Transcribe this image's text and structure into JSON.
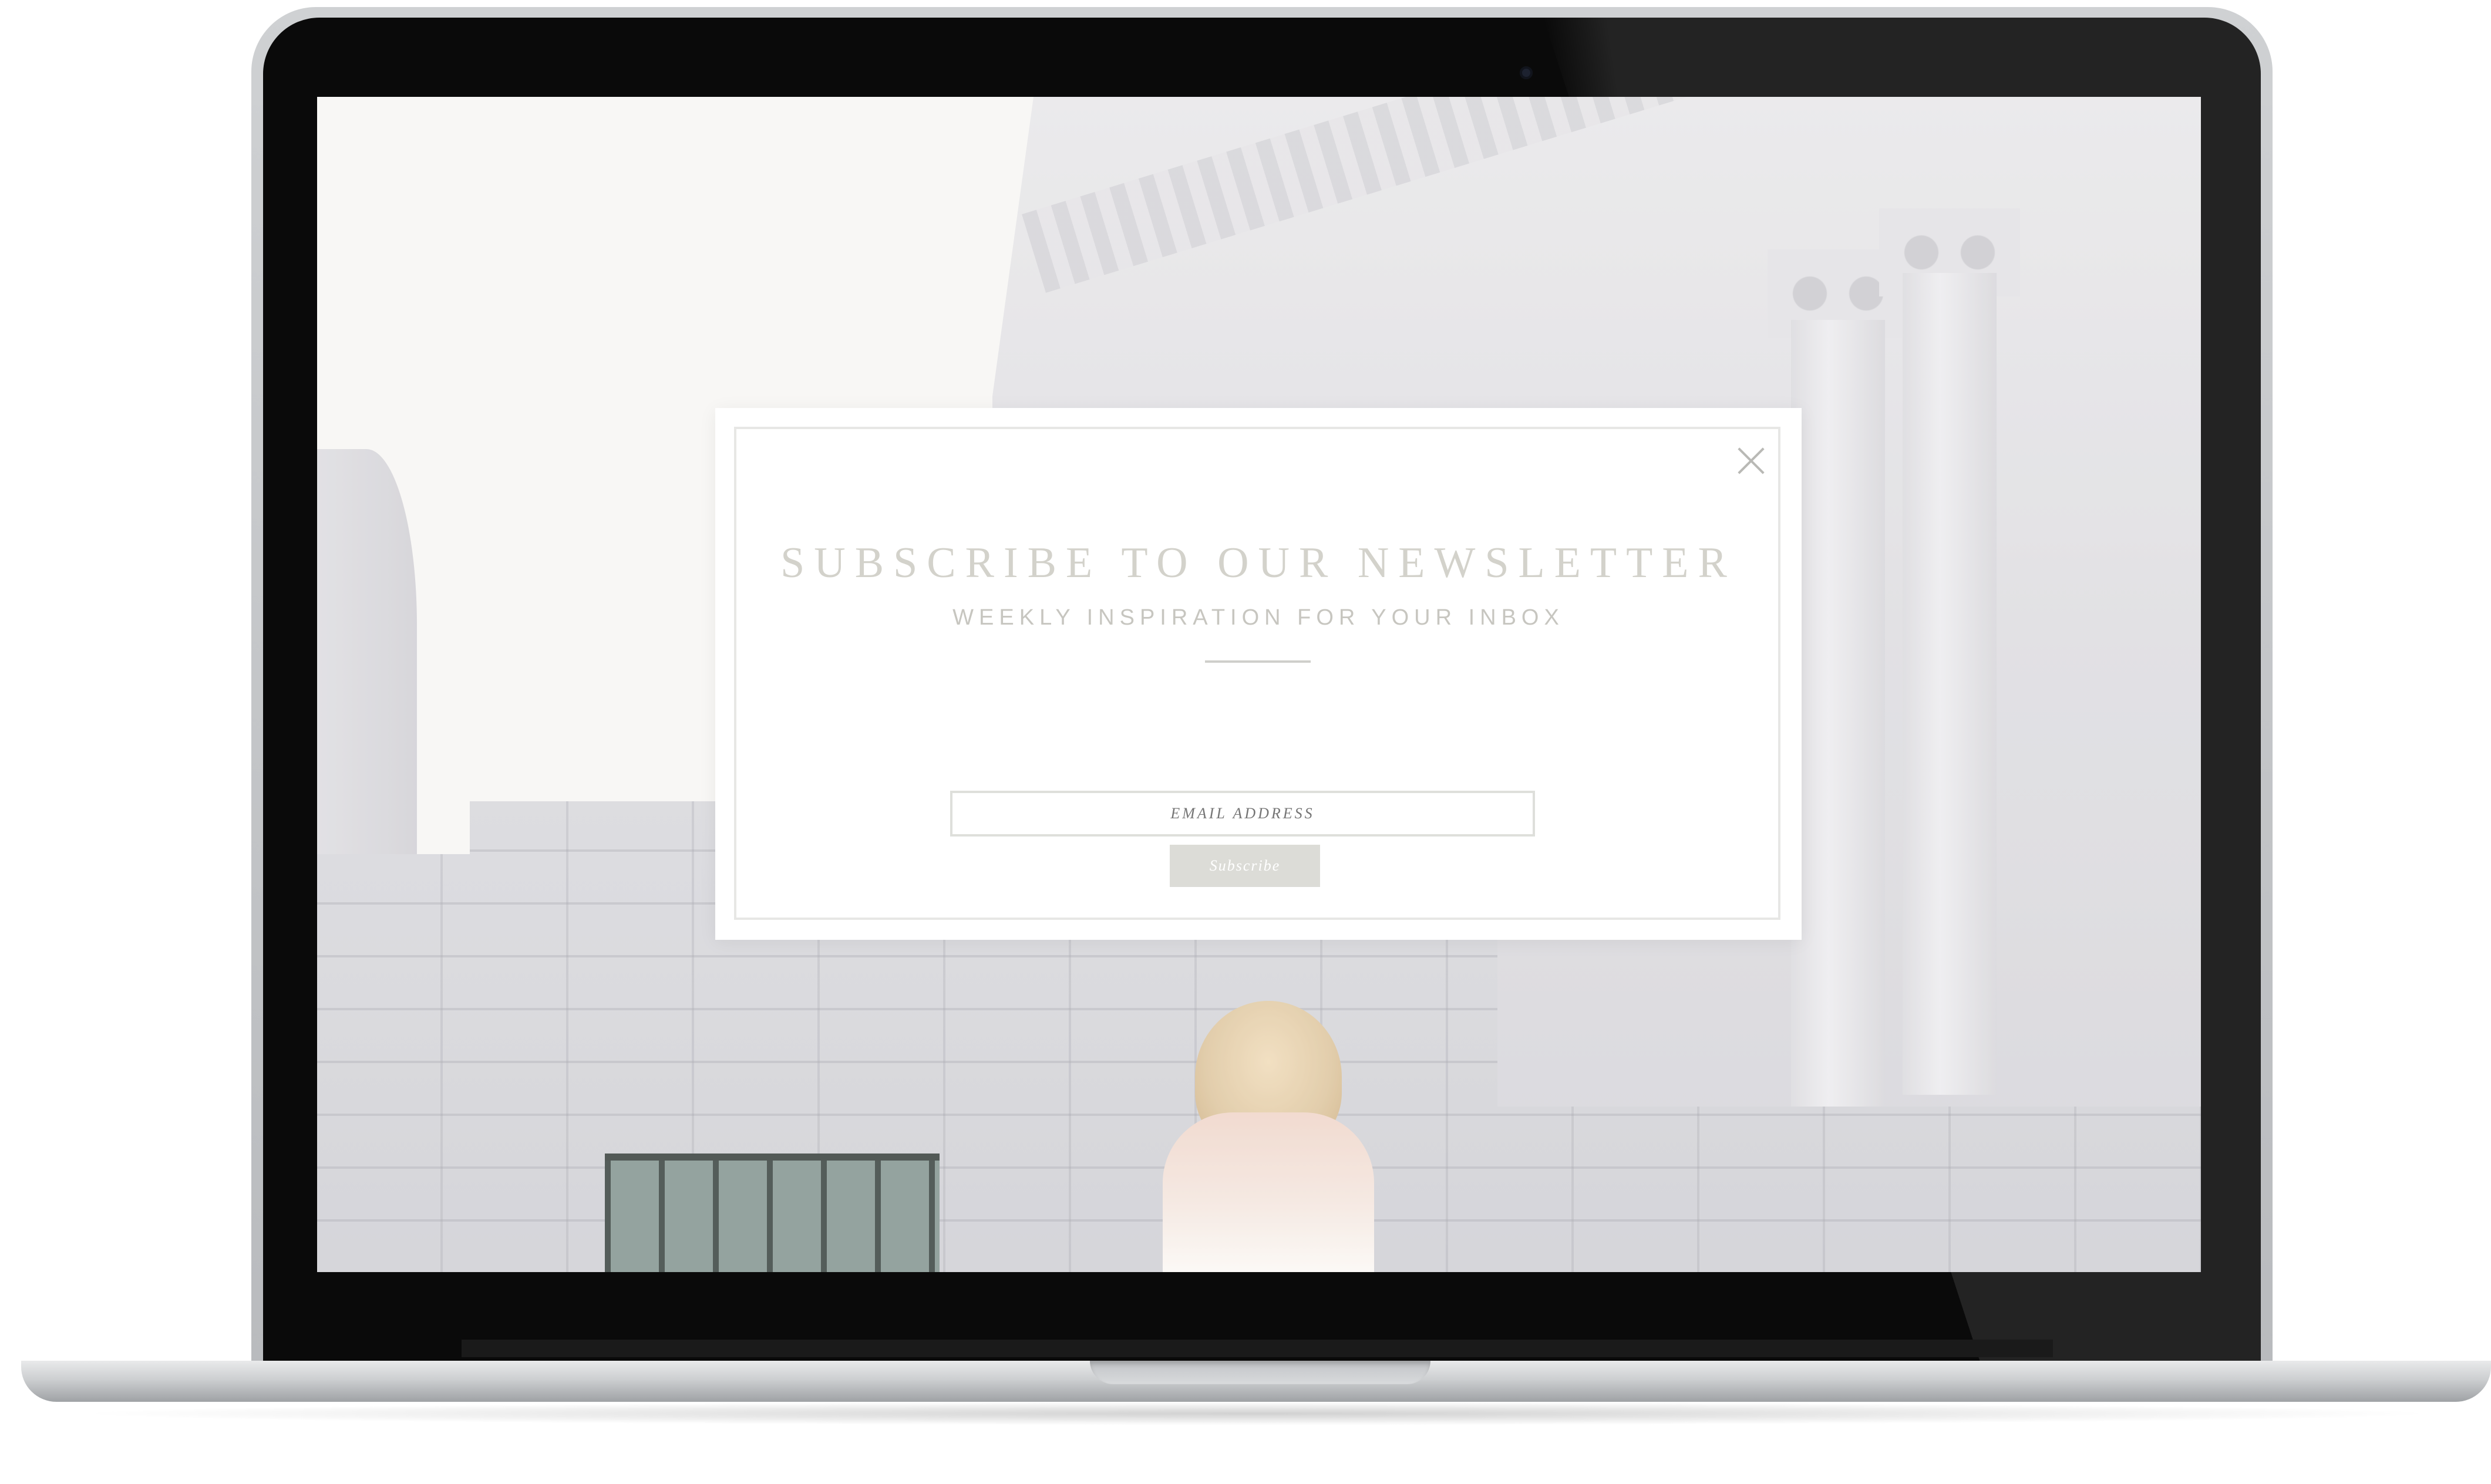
{
  "newsletter_popup": {
    "title": "SUBSCRIBE TO OUR NEWSLETTER",
    "subtitle": "WEEKLY INSPIRATION FOR YOUR INBOX",
    "email_placeholder": "EMAIL ADDRESS",
    "subscribe_label": "Subscribe",
    "close_icon": "close-icon"
  },
  "colors": {
    "title_text": "#d3d2cb",
    "subscribe_button_bg": "#dcdcd7",
    "modal_bg": "#ffffff",
    "frame_border": "#e7e7e5"
  }
}
